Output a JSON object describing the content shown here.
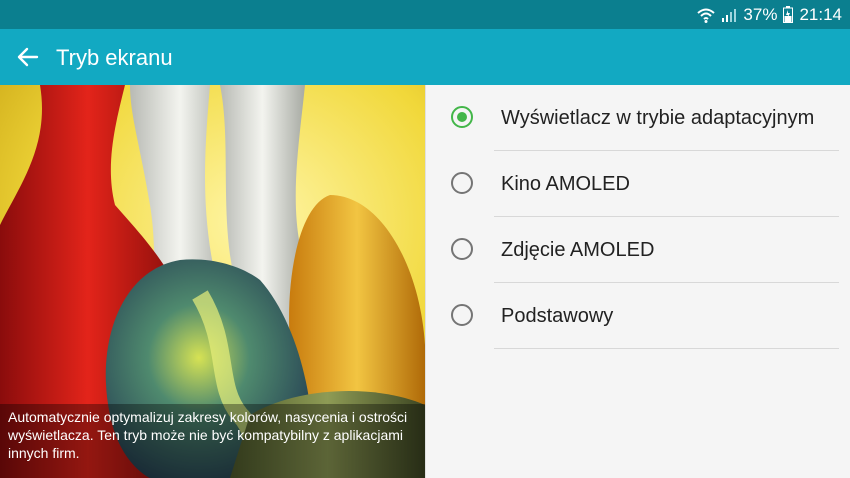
{
  "status": {
    "battery": "37%",
    "time": "21:14"
  },
  "appbar": {
    "title": "Tryb ekranu"
  },
  "preview": {
    "caption": "Automatycznie optymalizuj zakresy kolorów, nasycenia i ostrości wyświetlacza. Ten tryb może nie być kompatybilny z aplikacjami innych firm."
  },
  "options": [
    {
      "label": "Wyświetlacz w trybie adaptacyjnym",
      "selected": true
    },
    {
      "label": "Kino AMOLED",
      "selected": false
    },
    {
      "label": "Zdjęcie AMOLED",
      "selected": false
    },
    {
      "label": "Podstawowy",
      "selected": false
    }
  ],
  "colors": {
    "accent": "#43b649",
    "appbar": "#12a9c2",
    "statusbar": "#0b7f8f"
  }
}
